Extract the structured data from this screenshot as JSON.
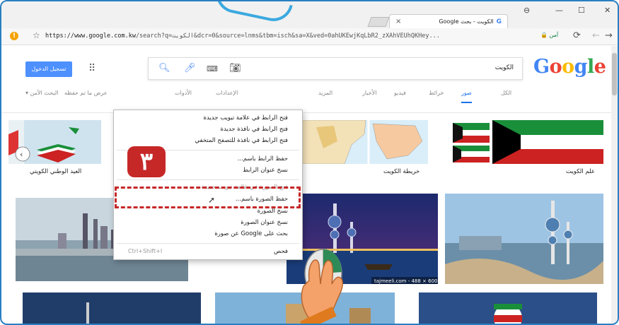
{
  "browser": {
    "tab_title": "الكويت - بحث Google",
    "tab_favicon": "G",
    "tab_close": "×",
    "url_prefix": "https://www.google.com.kw",
    "url_rest": "/search?q=الكويت&dcr=0&source=lnms&tbm=isch&sa=X&ved=0ahUKEwjKqLbR2_zXAhVEUhQKHey...",
    "secure_label": "آمن",
    "minimize": "—",
    "maximize": "☐",
    "close": "✕",
    "profile": "⊖"
  },
  "header": {
    "signin_label": "تسجيل الدخول",
    "search_query": "الكويت",
    "logo": [
      "G",
      "o",
      "o",
      "g",
      "l",
      "e"
    ]
  },
  "tabs": [
    {
      "label": "الكل"
    },
    {
      "label": "صور"
    },
    {
      "label": "خرائط"
    },
    {
      "label": "فيديو"
    },
    {
      "label": "الأخبار"
    },
    {
      "label": "المزيد"
    },
    {
      "label": "الإعدادات"
    },
    {
      "label": "الأدوات"
    },
    {
      "label": "عرض ما تم حفظه"
    },
    {
      "label": "البحث الآمن ▾"
    }
  ],
  "results": {
    "captions": [
      "علم الكويت",
      "خريطة الكويت",
      "العيد الوطني الكويتي"
    ],
    "watermark": "tajmeeli.com - 488 × 600"
  },
  "context_menu": {
    "items": [
      "فتح الرابط في علامة تبويب جديدة",
      "فتح الرابط في نافذة جديدة",
      "فتح الرابط في نافذة للتصفح المتخفي",
      "حفظ الرابط باسم...",
      "نسخ عنوان الرابط",
      "فتح الصورة في علامة تبويب جديدة",
      "حفظ الصورة باسم...",
      "نسخ الصورة",
      "نسخ عنوان الصورة",
      "بحث على Google عن صورة",
      "فحص"
    ],
    "shortcut": "Ctrl+Shift+I"
  },
  "badge_number": "٣",
  "colors": {
    "highlight": "#c62828",
    "frame": "#2a7fc2",
    "link_blue": "#1a73e8"
  }
}
